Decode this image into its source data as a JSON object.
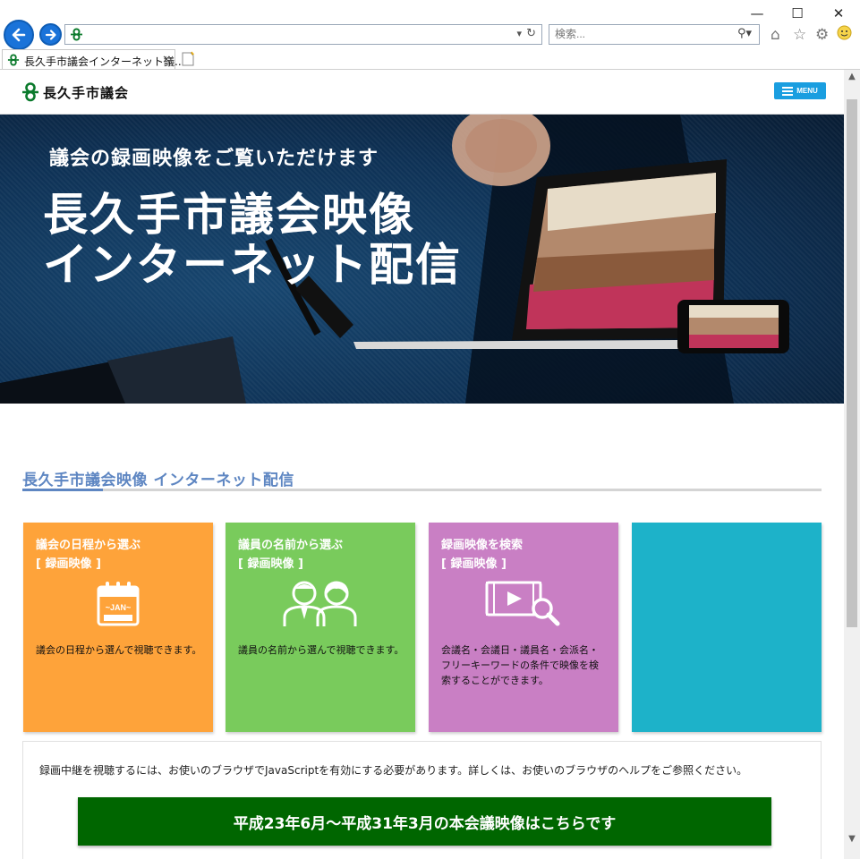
{
  "browser": {
    "window_controls": {
      "minimize": "—",
      "maximize": "☐",
      "close": "✕"
    },
    "address": {
      "value": "",
      "favicon": "nagakute-city-icon"
    },
    "search": {
      "placeholder": "検索..."
    },
    "tab": {
      "title": "長久手市議会インターネット議...",
      "close": "×"
    },
    "toolbar_icons": [
      "home-icon",
      "favorites-star-icon",
      "settings-gear-icon",
      "feedback-smiley-icon"
    ]
  },
  "site": {
    "logo_text": "長久手市議会",
    "menu_label": "MENU"
  },
  "hero": {
    "subtitle": "議会の録画映像をご覧いただけます",
    "title_line1": "長久手市議会映像",
    "title_line2": "インターネット配信"
  },
  "section": {
    "title": "長久手市議会映像 インターネット配信"
  },
  "cards": [
    {
      "title": "議会の日程から選ぶ",
      "tag": "[ 録画映像 ]",
      "icon": "calendar-icon",
      "icon_text": "~JAN~",
      "description": "議会の日程から選んで視聴できます。",
      "color": "#fea33a"
    },
    {
      "title": "議員の名前から選ぶ",
      "tag": "[ 録画映像 ]",
      "icon": "people-icon",
      "description": "議員の名前から選んで視聴できます。",
      "color": "#79cb5c"
    },
    {
      "title": "録画映像を検索",
      "tag": "[ 録画映像 ]",
      "icon": "video-search-icon",
      "description": "会議名・会議日・議員名・会派名・フリーキーワードの条件で映像を検索することができます。",
      "color": "#c97fc4"
    },
    {
      "title": "",
      "tag": "",
      "icon": "",
      "description": "",
      "color": "#1db2c9"
    }
  ],
  "notice": "録画中継を視聴するには、お使いのブラウザでJavaScriptを有効にする必要があります。詳しくは、お使いのブラウザのヘルプをご参照ください。",
  "archive_button": "平成23年6月～平成31年3月の本会議映像はこちらです",
  "colors": {
    "accent_blue": "#5e86c2",
    "menu_blue": "#1a9ee0",
    "archive_green": "#006600",
    "hero_navy": "#0e3155"
  }
}
